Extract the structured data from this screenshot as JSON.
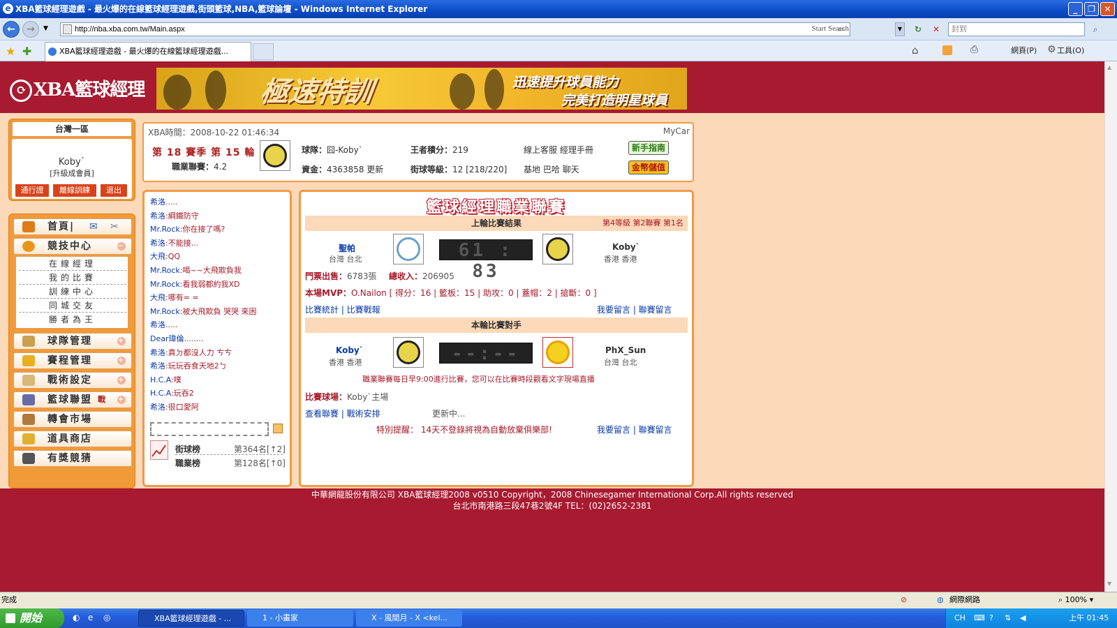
{
  "browser": {
    "window_title": "XBA籃球經理遊戲 - 最火爆的在線籃球經理遊戲,街頭籃球,NBA,籃球論壇 - Windows Internet Explorer",
    "url": "http://nba.xba.com.tw/Main.aspx",
    "start_search": "Start Search",
    "search_value": "封到",
    "tab_title": "XBA籃球經理遊戲 - 最火爆的在線籃球經理遊戲...",
    "toolbar_page": "網頁(P)",
    "toolbar_tools": "工具(O)",
    "status_left": "完成",
    "status_zone": "網際網路",
    "zoom": "100%"
  },
  "site": {
    "logo_text": "XBA籃球經理",
    "banner_title": "極速特訓",
    "banner_line1": "迅速提升球員能力",
    "banner_line2": "完美打造明星球員"
  },
  "user": {
    "region": "台灣一區",
    "name": "Koby`",
    "level": "[升級成會員]",
    "buttons": [
      "通行證",
      "離線訓練",
      "退出"
    ]
  },
  "menu": {
    "home": "首頁|",
    "items": [
      {
        "label": "競技中心",
        "icon": "basketball-icon"
      },
      {
        "label": "球隊管理",
        "icon": "team-icon"
      },
      {
        "label": "賽程管理",
        "icon": "trophy-icon"
      },
      {
        "label": "戰術設定",
        "icon": "tactics-icon"
      },
      {
        "label": "籃球聯盟",
        "icon": "league-icon",
        "badge": "戰"
      },
      {
        "label": "轉會市場",
        "icon": "hammer-icon"
      },
      {
        "label": "道具商店",
        "icon": "shop-icon"
      },
      {
        "label": "有獎競猜",
        "icon": "quiz-icon"
      }
    ],
    "sub_items": [
      "在線經理",
      "我的比賽",
      "訓練中心",
      "同城交友",
      "勝者為王"
    ]
  },
  "info": {
    "xba_time_label": "XBA時間：",
    "xba_time": "2008-10-22 01:46:34",
    "mycar": "MyCar",
    "season": "第 18 賽季 第 15 輪",
    "rating_label": "職業聯賽：",
    "rating": "4.2",
    "team_label": "球隊：",
    "team": "囧-Koby`",
    "points_label": "王者積分：",
    "points": "219",
    "service": "線上客服 經理手冊",
    "funds_label": "資金：",
    "funds": "4363858",
    "update": "更新",
    "street_label": "街球等級：",
    "street": "12 [218/220]",
    "base": "基地 巴哈 聊天",
    "btn_guide": "新手指南",
    "btn_gold": "金幣儲值"
  },
  "chat": {
    "messages": [
      {
        "name": "希洛",
        "text": "....."
      },
      {
        "name": "希洛",
        "text": ":綱鐵防守"
      },
      {
        "name": "Mr.Rock",
        "text": ":你在接了嗎?"
      },
      {
        "name": "希洛",
        "text": ":不能接..."
      },
      {
        "name": "大飛",
        "text": ":QQ"
      },
      {
        "name": "Mr.Rock",
        "text": ":喝~~大飛欺負我"
      },
      {
        "name": "Mr.Rock",
        "text": ":看我弱都約我XD"
      },
      {
        "name": "大飛",
        "text": ":哪有= ="
      },
      {
        "name": "Mr.Rock",
        "text": ":被大飛欺負 哭哭 來困"
      },
      {
        "name": "希洛",
        "text": "....."
      },
      {
        "name": "Dear瑋倫",
        "text": "........"
      },
      {
        "name": "希洛",
        "text": ":真ㄉ都沒人力 ㄘㄘ"
      },
      {
        "name": "希洛",
        "text": ":玩玩吞食天地2ㄅ"
      },
      {
        "name": "H.C.A",
        "text": ":噗"
      },
      {
        "name": "H.C.A",
        "text": ":玩吞2"
      },
      {
        "name": "希洛",
        "text": ":很口愛阿"
      }
    ],
    "rank_street_label": "街球榜",
    "rank_street": "第364名[↑2]",
    "rank_pro_label": "職業榜",
    "rank_pro": "第128名[↑0]"
  },
  "match": {
    "title": "籃球經理職業聯賽",
    "last_round_title": "上輪比賽結果",
    "last_round_info": "第4等級 第2聯賽 第1名",
    "home_team": "聖帕",
    "home_loc": "台灣 台北",
    "score": "61 : 83",
    "away_team": "Koby`",
    "away_loc": "香港 香港",
    "tickets_label": "門票出售：",
    "tickets": "6783張",
    "income_label": "總收入：",
    "income": "206905",
    "mvp_label": "本場MVP：",
    "mvp": "O.Nailon [ 得分：16 | 籃板：15 | 助攻：0 | 蓋帽：2 | 搶斷：0 ]",
    "links_left": "比賽統計 | 比賽戰報",
    "links_right": "我要留言 | 聯賽留言",
    "this_round_title": "本輪比賽對手",
    "next_home": "Koby`",
    "next_home_loc": "香港 香港",
    "next_score": "--:--",
    "next_away": "PhX_Sun",
    "next_away_loc": "台灣 台北",
    "notice": "職業聯賽每日早9:00進行比賽，您可以在比賽時段觀看文字現場直播",
    "venue_label": "比賽球場：",
    "venue": "Koby`主場",
    "links2_left": "查看聯賽 | 戰術安排",
    "updating": "更新中...",
    "reminder_label": "特別提醒：",
    "reminder": "14天不登錄將視為自動放棄俱樂部!",
    "links2_right": "我要留言 | 聯賽留言"
  },
  "footer": {
    "line1": "中華網龍股份有限公司 XBA籃球經理2008 v0510  Copyright，2008 Chinesegamer International Corp.All rights reserved",
    "line2": "台北市南港路三段47巷2號4F TEL：(02)2652-2381"
  },
  "taskbar": {
    "start": "開始",
    "tasks": [
      "XBA籃球經理遊戲 - ...",
      "1 - 小畫家",
      "X - 風間月 - X <kel..."
    ],
    "lang": "CH",
    "clock": "上午 01:45"
  }
}
